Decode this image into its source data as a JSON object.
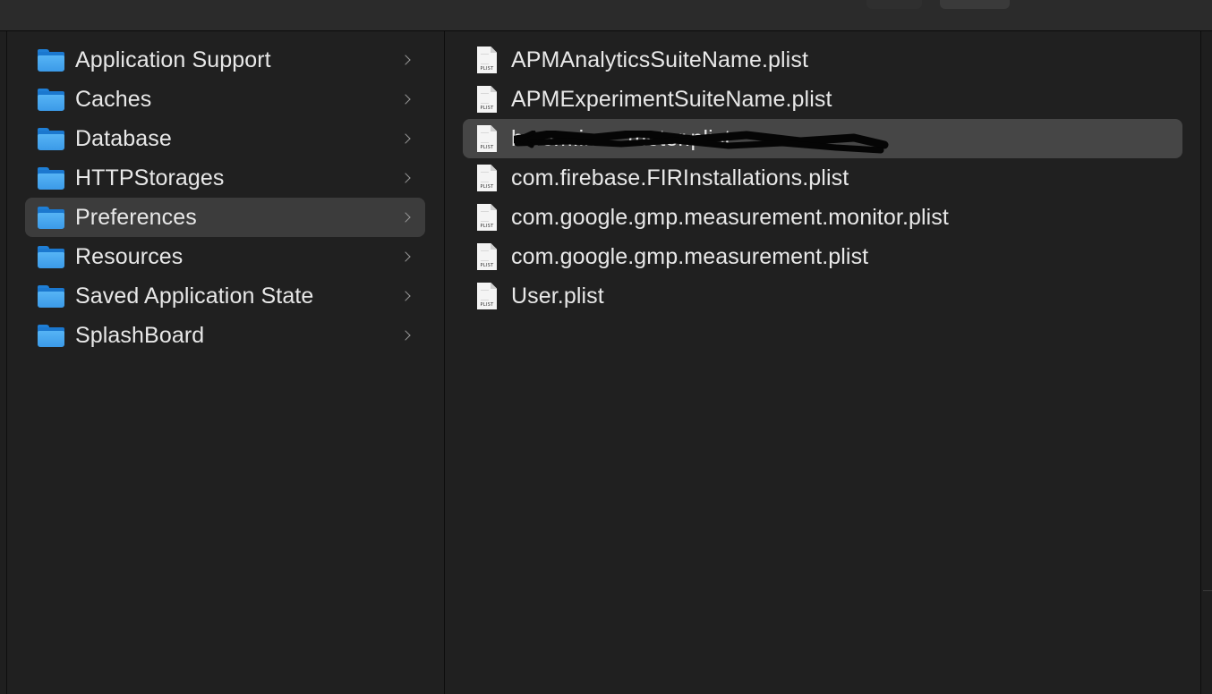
{
  "folders": [
    {
      "label": "Application Support",
      "icon": "folder-icon",
      "selected": false
    },
    {
      "label": "Caches",
      "icon": "folder-icon",
      "selected": false
    },
    {
      "label": "Database",
      "icon": "folder-icon",
      "selected": false
    },
    {
      "label": "HTTPStorages",
      "icon": "folder-icon",
      "selected": false
    },
    {
      "label": "Preferences",
      "icon": "folder-icon",
      "selected": true
    },
    {
      "label": "Resources",
      "icon": "folder-icon",
      "selected": false
    },
    {
      "label": "Saved Application State",
      "icon": "folder-icon",
      "selected": false
    },
    {
      "label": "SplashBoard",
      "icon": "folder-icon",
      "selected": false
    }
  ],
  "files": [
    {
      "label": "APMAnalyticsSuiteName.plist",
      "icon_label": "PLIST",
      "selected": false
    },
    {
      "label": "APMExperimentSuiteName.plist",
      "icon_label": "PLIST",
      "selected": false
    },
    {
      "label": "b.com.ine...moter.plist",
      "icon_label": "PLIST",
      "selected": true,
      "redacted": true
    },
    {
      "label": "com.firebase.FIRInstallations.plist",
      "icon_label": "PLIST",
      "selected": false
    },
    {
      "label": "com.google.gmp.measurement.monitor.plist",
      "icon_label": "PLIST",
      "selected": false
    },
    {
      "label": "com.google.gmp.measurement.plist",
      "icon_label": "PLIST",
      "selected": false
    },
    {
      "label": "User.plist",
      "icon_label": "PLIST",
      "selected": false
    }
  ],
  "colors": {
    "folder_blue": "#3b9ae8",
    "selection_folder": "#3c3c3c",
    "selection_file": "#464646",
    "background": "#1f1f1f"
  }
}
